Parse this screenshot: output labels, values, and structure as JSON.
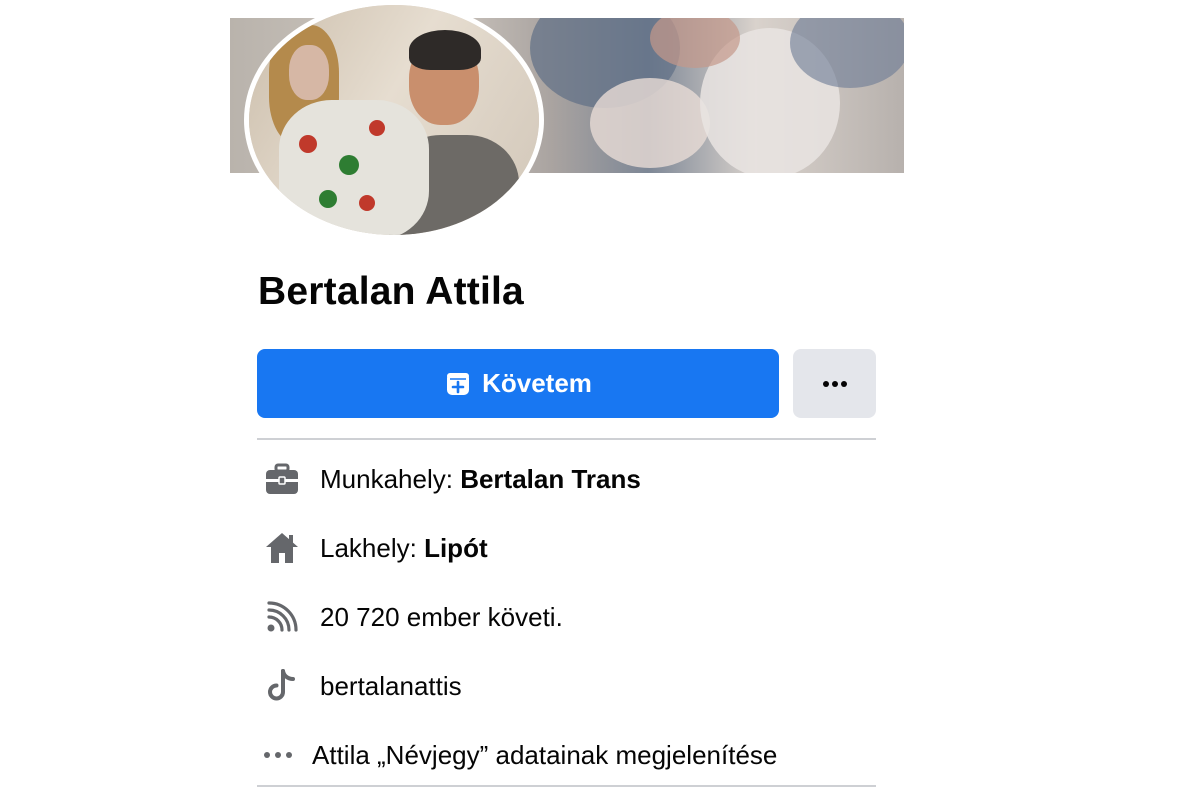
{
  "profile": {
    "name": "Bertalan Attila"
  },
  "actions": {
    "follow_label": "Követem",
    "more_label": "···"
  },
  "details": {
    "work_prefix": "Munkahely: ",
    "work_value": "Bertalan Trans",
    "home_prefix": "Lakhely: ",
    "home_value": "Lipót",
    "followers_text": "20 720 ember követi.",
    "tiktok_handle": "bertalanattis",
    "about_link": "Attila „Névjegy” adatainak megjelenítése"
  },
  "icons": {
    "follow": "follow-icon",
    "more": "more-dots-icon",
    "work": "briefcase-icon",
    "home": "home-icon",
    "followers": "rss-icon",
    "tiktok": "tiktok-icon",
    "about": "dots-icon"
  },
  "colors": {
    "accent": "#1877f2",
    "secondary_button": "#e4e6eb",
    "icon_gray": "#65676b",
    "divider": "#ced0d4"
  }
}
